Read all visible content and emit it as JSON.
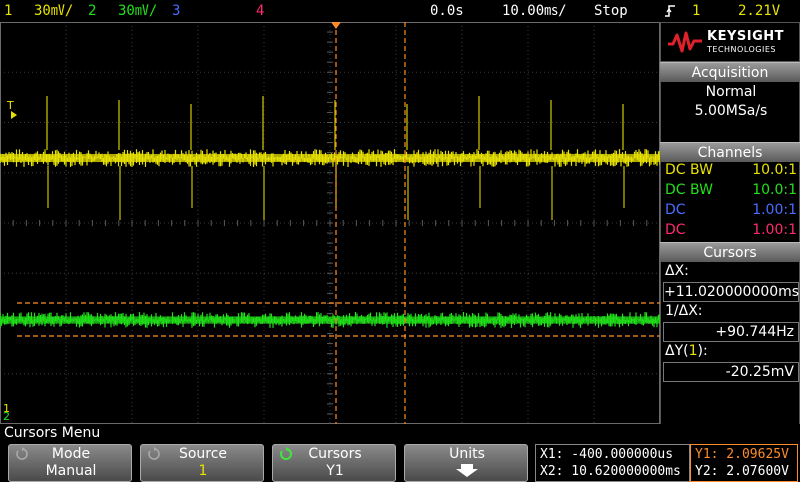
{
  "topbar": {
    "ch1_num": "1",
    "ch1_scale": "30㎷/",
    "ch2_num": "2",
    "ch2_scale": "30㎷/",
    "ch3_num": "3",
    "ch4_num": "4",
    "time_delay": "0.0s",
    "time_scale": "10.00㎳/",
    "run_state": "Stop",
    "trigger_icon": "rising-edge-trigger-icon",
    "trigger_source": "1",
    "trigger_level": "2.21V"
  },
  "colors": {
    "ch1": "#e8e200",
    "ch2": "#22e01a",
    "ch3": "#4a6cff",
    "ch4": "#ff2a6e",
    "cursor": "#ff8c2a",
    "grid": "#3c3c3c"
  },
  "graticule": {
    "trigger_marker": "T",
    "ch1_marker": "1",
    "ch2_marker": "2"
  },
  "logo": {
    "brand": "KEYSIGHT",
    "subbrand": "TECHNOLOGIES"
  },
  "acquisition": {
    "heading": "Acquisition",
    "mode": "Normal",
    "rate": "5.00MSa/s"
  },
  "channels": {
    "heading": "Channels",
    "rows": [
      {
        "coupling": "DC BW",
        "probe": "10.0:1"
      },
      {
        "coupling": "DC BW",
        "probe": "10.0:1"
      },
      {
        "coupling": "DC",
        "probe": "1.00:1"
      },
      {
        "coupling": "DC",
        "probe": "1.00:1"
      }
    ]
  },
  "cursors_panel": {
    "heading": "Cursors",
    "dx_label": "ΔX:",
    "dx_value": "+11.020000000ms",
    "inv_dx_label": "1/ΔX:",
    "inv_dx_value": "+90.744Hz",
    "dy_label_prefix": "ΔY(",
    "dy_label_channel": "1",
    "dy_label_suffix": "):",
    "dy_value": "-20.25mV"
  },
  "menu": {
    "title": "Cursors Menu",
    "softkeys": [
      {
        "label": "Mode",
        "value": "Manual"
      },
      {
        "label": "Source",
        "value": "1"
      },
      {
        "label": "Cursors",
        "value": "Y1"
      },
      {
        "label": "Units",
        "value": ""
      }
    ],
    "readout": {
      "x1": "X1: -400.000000us",
      "x2": "X2: 10.620000000ms",
      "y1": "Y1: 2.09625V",
      "y2": "Y2: 2.07600V"
    }
  }
}
